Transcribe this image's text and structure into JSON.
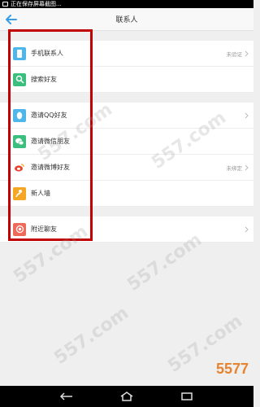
{
  "status_bar": {
    "text": "正在保存屏幕截图..."
  },
  "header": {
    "title": "联系人"
  },
  "list": {
    "group1": [
      {
        "label": "手机联系人",
        "status": "未验证",
        "icon": "phone-icon",
        "color": "#4eb6e8"
      },
      {
        "label": "搜索好友",
        "status": "",
        "icon": "search-friend-icon",
        "color": "#3cbf7e"
      }
    ],
    "group2": [
      {
        "label": "邀请QQ好友",
        "status": "",
        "icon": "qq-icon",
        "color": "#4eb6e8"
      },
      {
        "label": "邀请微信朋友",
        "status": "",
        "icon": "wechat-icon",
        "color": "#3cbf7e"
      },
      {
        "label": "邀请微博好友",
        "status": "未绑定",
        "icon": "weibo-icon",
        "color": "#f07a3c"
      },
      {
        "label": "新人墙",
        "status": "",
        "icon": "new-people-icon",
        "color": "#f5a623"
      }
    ],
    "group3": [
      {
        "label": "附近聊友",
        "status": "",
        "icon": "nearby-icon",
        "color": "#f06a5a"
      }
    ]
  },
  "watermark": {
    "text": "557.com",
    "brand": "5577"
  }
}
